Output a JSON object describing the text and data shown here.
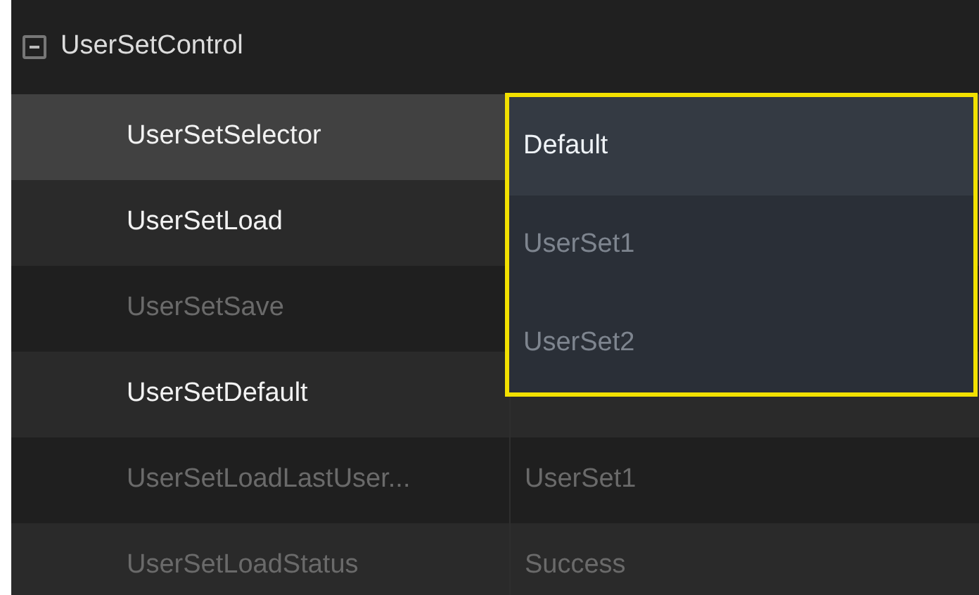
{
  "group": {
    "label": "UserSetControl",
    "expanded": true
  },
  "rows": [
    {
      "name": "UserSetSelector",
      "enabled": true,
      "selected": true
    },
    {
      "name": "UserSetLoad",
      "enabled": true,
      "selected": false
    },
    {
      "name": "UserSetSave",
      "enabled": false,
      "selected": false
    },
    {
      "name": "UserSetDefault",
      "enabled": true,
      "selected": false
    },
    {
      "name": "UserSetLoadLastUser...",
      "value": "UserSet1",
      "enabled": false,
      "selected": false
    },
    {
      "name": "UserSetLoadStatus",
      "value": "Success",
      "enabled": false,
      "selected": false
    }
  ],
  "dropdown": {
    "options": [
      {
        "label": "Default",
        "selected": true
      },
      {
        "label": "UserSet1",
        "selected": false
      },
      {
        "label": "UserSet2",
        "selected": false
      }
    ]
  }
}
